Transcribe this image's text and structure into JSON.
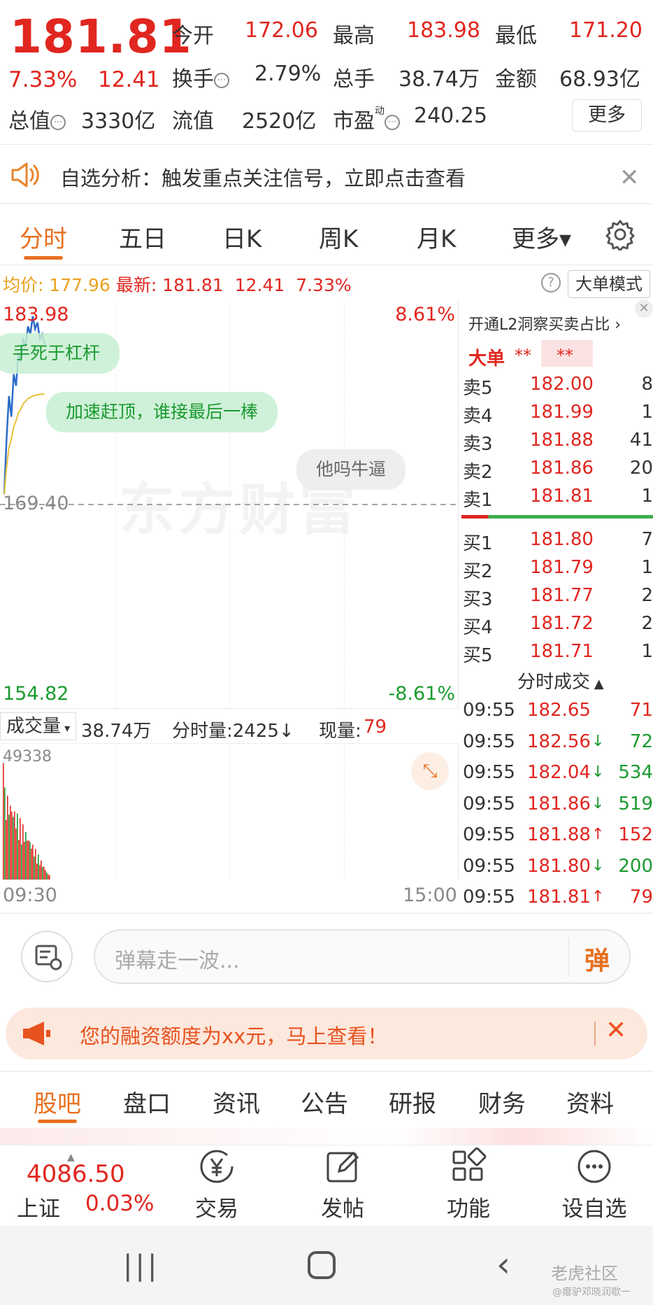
{
  "quote": {
    "price": "181.81",
    "change_pct": "7.33%",
    "change_abs": "12.41",
    "stats": [
      {
        "label": "今开",
        "value": "172.06",
        "color": "red"
      },
      {
        "label": "最高",
        "value": "183.98",
        "color": "red"
      },
      {
        "label": "最低",
        "value": "171.20",
        "color": "red"
      },
      {
        "label": "换手",
        "value": "2.79%",
        "color": "dark"
      },
      {
        "label": "总手",
        "value": "38.74万",
        "color": "dark"
      },
      {
        "label": "金额",
        "value": "68.93亿",
        "color": "dark"
      },
      {
        "label": "总值",
        "value": "3330亿",
        "color": "dark"
      },
      {
        "label": "流值",
        "value": "2520亿",
        "color": "dark"
      },
      {
        "label": "市盈",
        "value": "240.25",
        "color": "dark"
      }
    ],
    "pe_superscript": "动",
    "more_label": "更多"
  },
  "notice": {
    "text": "自选分析：触发重点关注信号，立即点击查看"
  },
  "tabs": [
    "分时",
    "五日",
    "日K",
    "周K",
    "月K",
    "更多▾"
  ],
  "chart_header": {
    "avg_label": "均价:",
    "avg_value": "177.96",
    "latest_label": "最新:",
    "latest_value": "181.81",
    "change_abs": "12.41",
    "change_pct": "7.33%",
    "mode_button": "大单模式"
  },
  "chart": {
    "high_label": "183.98",
    "high_pct": "8.61%",
    "mid_label": "169.40",
    "low_label": "154.82",
    "low_pct": "-8.61%",
    "watermark": "东方财富",
    "time_start": "09:30",
    "time_end": "15:00",
    "danmaku": [
      "手死于杠杆",
      "加速赶顶，谁接最后一棒",
      "他吗牛逼"
    ]
  },
  "volume": {
    "label": "成交量",
    "total": "38.74万",
    "minute_label": "分时量:2425↓",
    "current_label": "现量:",
    "current_value": "79",
    "max_label": "49338"
  },
  "chart_data": {
    "type": "line",
    "title": "",
    "ylim": [
      154.82,
      183.98
    ],
    "series": [
      {
        "values": [
          170.2,
          174.5,
          177.8,
          176.2,
          179.5,
          178.6,
          181.2,
          180.4,
          182.3,
          181.6,
          183.2,
          182.6,
          183.98,
          183.0,
          183.5,
          182.2,
          182.6,
          181.81
        ]
      },
      {
        "values": [
          170.2,
          172.3,
          173.8,
          174.5,
          175.4,
          175.9,
          176.5,
          176.8,
          177.2,
          177.4,
          177.6,
          177.7,
          177.8,
          177.85,
          177.9,
          177.93,
          177.95,
          177.96
        ]
      }
    ]
  },
  "orderbook": {
    "open_l2": "开通L2洞察买卖占比",
    "bigorder_label": "大单",
    "bigorder_value1": "**",
    "bigorder_value2": "**",
    "asks": [
      {
        "label": "卖5",
        "price": "182.00",
        "vol": "8"
      },
      {
        "label": "卖4",
        "price": "181.99",
        "vol": "1"
      },
      {
        "label": "卖3",
        "price": "181.88",
        "vol": "41"
      },
      {
        "label": "卖2",
        "price": "181.86",
        "vol": "20"
      },
      {
        "label": "卖1",
        "price": "181.81",
        "vol": "1"
      }
    ],
    "bids": [
      {
        "label": "买1",
        "price": "181.80",
        "vol": "7"
      },
      {
        "label": "买2",
        "price": "181.79",
        "vol": "1"
      },
      {
        "label": "买3",
        "price": "181.77",
        "vol": "2"
      },
      {
        "label": "买4",
        "price": "181.72",
        "vol": "2"
      },
      {
        "label": "买5",
        "price": "181.71",
        "vol": "1"
      }
    ]
  },
  "trades": {
    "title": "分时成交",
    "rows": [
      {
        "time": "09:55",
        "price": "182.65",
        "arrow": "",
        "vol": "71",
        "vol_color": "red"
      },
      {
        "time": "09:55",
        "price": "182.56",
        "arrow": "↓",
        "vol": "72",
        "vol_color": "green"
      },
      {
        "time": "09:55",
        "price": "182.04",
        "arrow": "↓",
        "vol": "534",
        "vol_color": "green"
      },
      {
        "time": "09:55",
        "price": "181.86",
        "arrow": "↓",
        "vol": "519",
        "vol_color": "green"
      },
      {
        "time": "09:55",
        "price": "181.88",
        "arrow": "↑",
        "vol": "152",
        "vol_color": "red"
      },
      {
        "time": "09:55",
        "price": "181.80",
        "arrow": "↓",
        "vol": "200",
        "vol_color": "green"
      },
      {
        "time": "09:55",
        "price": "181.81",
        "arrow": "↑",
        "vol": "79",
        "vol_color": "red"
      }
    ]
  },
  "danmaku_input": {
    "placeholder": "弹幕走一波...",
    "send": "弹"
  },
  "financing": {
    "text": "您的融资额度为xx元，马上查看！"
  },
  "bottom_tabs": [
    "股吧",
    "盘口",
    "资讯",
    "公告",
    "研报",
    "财务",
    "资料"
  ],
  "index": {
    "value": "4086.50",
    "name": "上证",
    "change": "0.03%"
  },
  "nav": [
    "交易",
    "发帖",
    "功能",
    "设自选"
  ],
  "watermark_text": "老虎社区",
  "watermark_sub": "@瘪驴邓晓润歇一"
}
